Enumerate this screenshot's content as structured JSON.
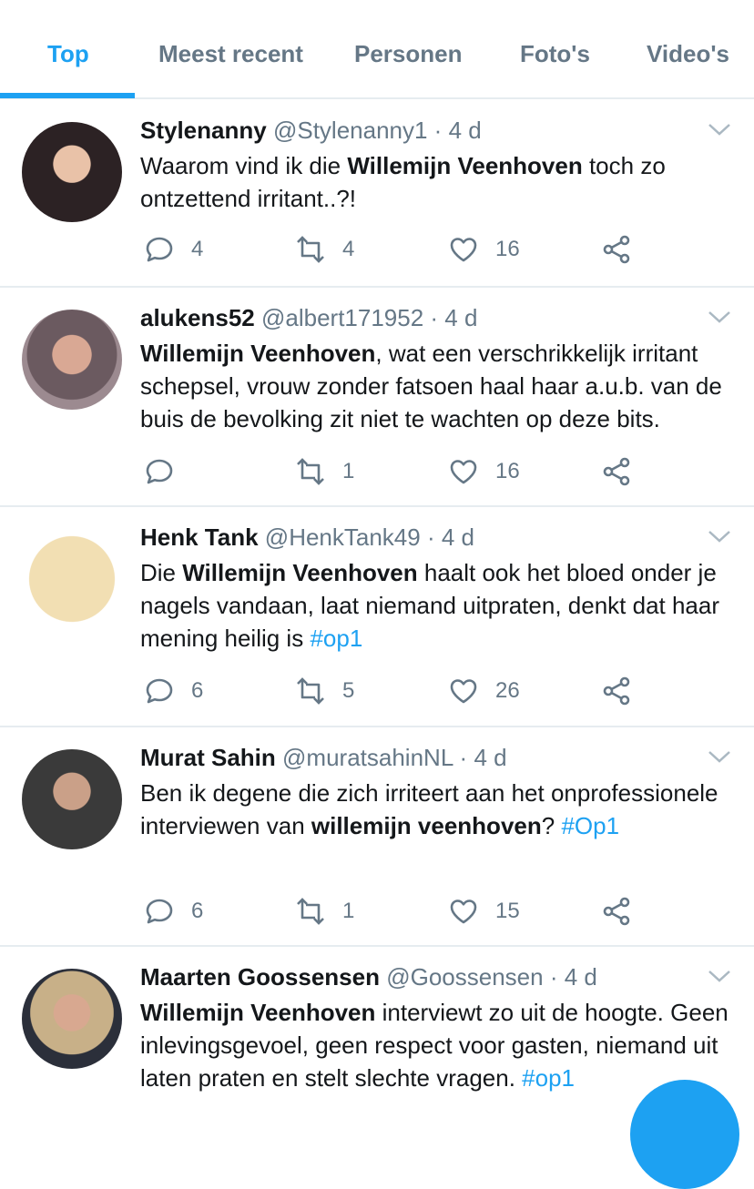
{
  "tabs": [
    {
      "label": "Top",
      "active": true
    },
    {
      "label": "Meest recent",
      "active": false
    },
    {
      "label": "Personen",
      "active": false
    },
    {
      "label": "Foto's",
      "active": false
    },
    {
      "label": "Video's",
      "active": false
    }
  ],
  "colors": {
    "accent": "#1da1f2",
    "secondary_text": "#657786",
    "divider": "#e6ecf0"
  },
  "tweets": [
    {
      "name": "Stylenanny",
      "handle": "@Stylenanny1",
      "dot": "·",
      "time": "4 d",
      "text": [
        {
          "t": "Waarom vind ik die "
        },
        {
          "t": "Willemijn Veenhoven",
          "bold": true
        },
        {
          "t": " toch zo ontzettend irritant..?!"
        }
      ],
      "replies": "4",
      "retweets": "4",
      "likes": "16"
    },
    {
      "name": "alukens52",
      "handle": "@albert171952",
      "dot": "·",
      "time": "4 d",
      "text": [
        {
          "t": "Willemijn Veenhoven",
          "bold": true
        },
        {
          "t": ", wat een verschrikkelijk irritant schepsel, vrouw zonder fatsoen haal haar a.u.b. van de buis de bevolking zit niet te wachten op deze bits."
        }
      ],
      "replies": "",
      "retweets": "1",
      "likes": "16"
    },
    {
      "name": "Henk Tank",
      "handle": "@HenkTank49",
      "dot": "·",
      "time": "4 d",
      "text": [
        {
          "t": "Die "
        },
        {
          "t": "Willemijn Veenhoven",
          "bold": true
        },
        {
          "t": " haalt ook het bloed onder je nagels vandaan, laat niemand uitpraten, denkt dat haar mening heilig is "
        },
        {
          "t": "#op1",
          "hashtag": true
        }
      ],
      "replies": "6",
      "retweets": "5",
      "likes": "26"
    },
    {
      "name": "Murat Sahin",
      "handle": "@muratsahinNL",
      "dot": "·",
      "time": "4 d",
      "text": [
        {
          "t": "Ben ik degene die zich irriteert aan het onprofessionele interviewen van "
        },
        {
          "t": "willemijn veenhoven",
          "bold": true
        },
        {
          "t": "? "
        },
        {
          "t": "#Op1",
          "hashtag": true
        }
      ],
      "replies": "6",
      "retweets": "1",
      "likes": "15"
    },
    {
      "name": "Maarten Goossensen",
      "handle": "@Goossensen",
      "dot": "·",
      "time": "4 d",
      "text": [
        {
          "t": "Willemijn Veenhoven",
          "bold": true
        },
        {
          "t": " interviewt zo uit de hoogte. Geen inlevingsgevoel, geen respect voor gasten, niemand uit laten praten en stelt slechte vragen. "
        },
        {
          "t": "#op1",
          "hashtag": true
        }
      ],
      "replies": "",
      "retweets": "",
      "likes": ""
    }
  ]
}
